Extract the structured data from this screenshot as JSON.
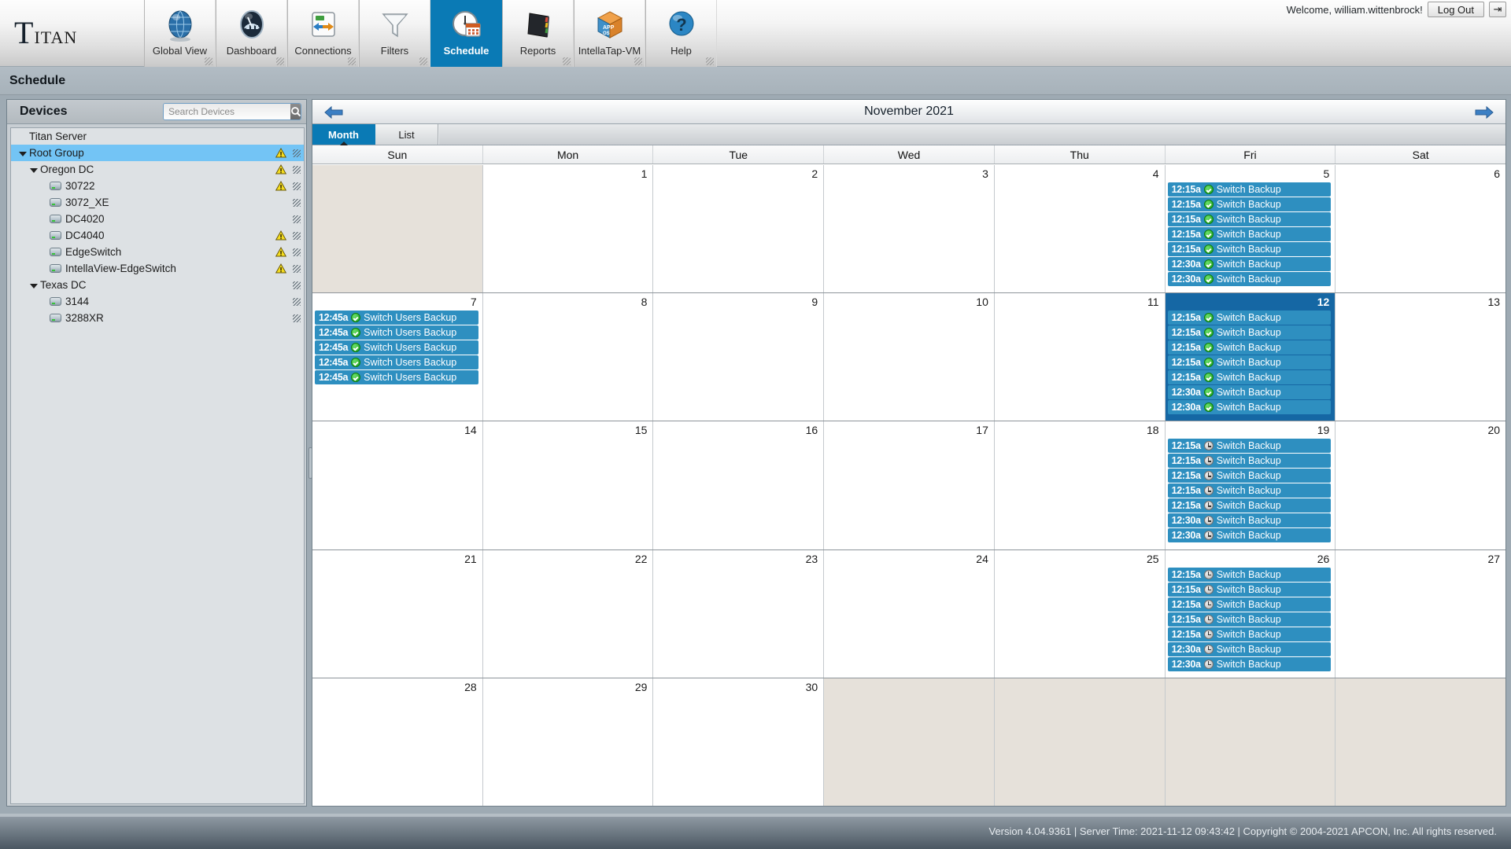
{
  "app": {
    "logo_first": "T",
    "logo_rest": "itan",
    "page_title": "Schedule"
  },
  "user": {
    "welcome": "Welcome, william.wittenbrock!",
    "logout_label": "Log Out",
    "logout_icon": "exit-icon"
  },
  "nav": {
    "items": [
      {
        "label": "Global View",
        "icon": "globe-icon",
        "active": false
      },
      {
        "label": "Dashboard",
        "icon": "gauge-icon",
        "active": false
      },
      {
        "label": "Connections",
        "icon": "arrows-icon",
        "active": false
      },
      {
        "label": "Filters",
        "icon": "funnel-icon",
        "active": false
      },
      {
        "label": "Schedule",
        "icon": "clock-calendar-icon",
        "active": true
      },
      {
        "label": "Reports",
        "icon": "notebook-icon",
        "active": false
      },
      {
        "label": "IntellaTap-VM",
        "icon": "cube-icon",
        "active": false
      },
      {
        "label": "Help",
        "icon": "question-icon",
        "active": false
      }
    ]
  },
  "sidebar": {
    "title": "Devices",
    "search": {
      "placeholder": "Search Devices",
      "value": "",
      "icon": "search-icon"
    },
    "tree": [
      {
        "label": "Titan Server",
        "indent": 0,
        "type": "server",
        "twisty": "none",
        "warn": false,
        "grip": false,
        "selected": false
      },
      {
        "label": "Root Group",
        "indent": 0,
        "type": "group",
        "twisty": "open",
        "warn": true,
        "grip": true,
        "selected": true
      },
      {
        "label": "Oregon DC",
        "indent": 1,
        "type": "group",
        "twisty": "open",
        "warn": true,
        "grip": true,
        "selected": false
      },
      {
        "label": "30722",
        "indent": 2,
        "type": "device",
        "twisty": "none",
        "warn": true,
        "grip": true,
        "selected": false
      },
      {
        "label": "3072_XE",
        "indent": 2,
        "type": "device",
        "twisty": "none",
        "warn": false,
        "grip": true,
        "selected": false
      },
      {
        "label": "DC4020",
        "indent": 2,
        "type": "device",
        "twisty": "none",
        "warn": false,
        "grip": true,
        "selected": false
      },
      {
        "label": "DC4040",
        "indent": 2,
        "type": "device",
        "twisty": "none",
        "warn": true,
        "grip": true,
        "selected": false
      },
      {
        "label": "EdgeSwitch",
        "indent": 2,
        "type": "device",
        "twisty": "none",
        "warn": true,
        "grip": true,
        "selected": false
      },
      {
        "label": "IntellaView-EdgeSwitch",
        "indent": 2,
        "type": "device",
        "twisty": "none",
        "warn": true,
        "grip": true,
        "selected": false
      },
      {
        "label": "Texas DC",
        "indent": 1,
        "type": "group",
        "twisty": "open",
        "warn": false,
        "grip": true,
        "selected": false
      },
      {
        "label": "3144",
        "indent": 2,
        "type": "device",
        "twisty": "none",
        "warn": false,
        "grip": true,
        "selected": false
      },
      {
        "label": "3288XR",
        "indent": 2,
        "type": "device",
        "twisty": "none",
        "warn": false,
        "grip": true,
        "selected": false
      }
    ]
  },
  "calendar": {
    "month_title": "November 2021",
    "prev_icon": "arrow-left-icon",
    "next_icon": "arrow-right-icon",
    "tabs": [
      {
        "label": "Month",
        "active": true
      },
      {
        "label": "List",
        "active": false
      }
    ],
    "day_headers": [
      "Sun",
      "Mon",
      "Tue",
      "Wed",
      "Thu",
      "Fri",
      "Sat"
    ],
    "weeks": [
      [
        {
          "num": "",
          "other": true,
          "today": false,
          "events": []
        },
        {
          "num": "1",
          "other": false,
          "today": false,
          "events": []
        },
        {
          "num": "2",
          "other": false,
          "today": false,
          "events": []
        },
        {
          "num": "3",
          "other": false,
          "today": false,
          "events": []
        },
        {
          "num": "4",
          "other": false,
          "today": false,
          "events": []
        },
        {
          "num": "5",
          "other": false,
          "today": false,
          "events": [
            {
              "time": "12:15a",
              "name": "Switch Backup",
              "status": "ok"
            },
            {
              "time": "12:15a",
              "name": "Switch Backup",
              "status": "ok"
            },
            {
              "time": "12:15a",
              "name": "Switch Backup",
              "status": "ok"
            },
            {
              "time": "12:15a",
              "name": "Switch Backup",
              "status": "ok"
            },
            {
              "time": "12:15a",
              "name": "Switch Backup",
              "status": "ok"
            },
            {
              "time": "12:30a",
              "name": "Switch Backup",
              "status": "ok"
            },
            {
              "time": "12:30a",
              "name": "Switch Backup",
              "status": "ok"
            }
          ]
        },
        {
          "num": "6",
          "other": false,
          "today": false,
          "events": []
        }
      ],
      [
        {
          "num": "7",
          "other": false,
          "today": false,
          "events": [
            {
              "time": "12:45a",
              "name": "Switch Users Backup",
              "status": "ok"
            },
            {
              "time": "12:45a",
              "name": "Switch Users Backup",
              "status": "ok"
            },
            {
              "time": "12:45a",
              "name": "Switch Users Backup",
              "status": "ok"
            },
            {
              "time": "12:45a",
              "name": "Switch Users Backup",
              "status": "ok"
            },
            {
              "time": "12:45a",
              "name": "Switch Users Backup",
              "status": "ok"
            }
          ]
        },
        {
          "num": "8",
          "other": false,
          "today": false,
          "events": []
        },
        {
          "num": "9",
          "other": false,
          "today": false,
          "events": []
        },
        {
          "num": "10",
          "other": false,
          "today": false,
          "events": []
        },
        {
          "num": "11",
          "other": false,
          "today": false,
          "events": []
        },
        {
          "num": "12",
          "other": false,
          "today": true,
          "events": [
            {
              "time": "12:15a",
              "name": "Switch Backup",
              "status": "ok"
            },
            {
              "time": "12:15a",
              "name": "Switch Backup",
              "status": "ok"
            },
            {
              "time": "12:15a",
              "name": "Switch Backup",
              "status": "ok"
            },
            {
              "time": "12:15a",
              "name": "Switch Backup",
              "status": "ok"
            },
            {
              "time": "12:15a",
              "name": "Switch Backup",
              "status": "ok"
            },
            {
              "time": "12:30a",
              "name": "Switch Backup",
              "status": "ok"
            },
            {
              "time": "12:30a",
              "name": "Switch Backup",
              "status": "ok"
            }
          ]
        },
        {
          "num": "13",
          "other": false,
          "today": false,
          "events": []
        }
      ],
      [
        {
          "num": "14",
          "other": false,
          "today": false,
          "events": []
        },
        {
          "num": "15",
          "other": false,
          "today": false,
          "events": []
        },
        {
          "num": "16",
          "other": false,
          "today": false,
          "events": []
        },
        {
          "num": "17",
          "other": false,
          "today": false,
          "events": []
        },
        {
          "num": "18",
          "other": false,
          "today": false,
          "events": []
        },
        {
          "num": "19",
          "other": false,
          "today": false,
          "events": [
            {
              "time": "12:15a",
              "name": "Switch Backup",
              "status": "pending"
            },
            {
              "time": "12:15a",
              "name": "Switch Backup",
              "status": "pending"
            },
            {
              "time": "12:15a",
              "name": "Switch Backup",
              "status": "pending"
            },
            {
              "time": "12:15a",
              "name": "Switch Backup",
              "status": "pending"
            },
            {
              "time": "12:15a",
              "name": "Switch Backup",
              "status": "pending"
            },
            {
              "time": "12:30a",
              "name": "Switch Backup",
              "status": "pending"
            },
            {
              "time": "12:30a",
              "name": "Switch Backup",
              "status": "pending"
            }
          ]
        },
        {
          "num": "20",
          "other": false,
          "today": false,
          "events": []
        }
      ],
      [
        {
          "num": "21",
          "other": false,
          "today": false,
          "events": []
        },
        {
          "num": "22",
          "other": false,
          "today": false,
          "events": []
        },
        {
          "num": "23",
          "other": false,
          "today": false,
          "events": []
        },
        {
          "num": "24",
          "other": false,
          "today": false,
          "events": []
        },
        {
          "num": "25",
          "other": false,
          "today": false,
          "events": []
        },
        {
          "num": "26",
          "other": false,
          "today": false,
          "events": [
            {
              "time": "12:15a",
              "name": "Switch Backup",
              "status": "pending"
            },
            {
              "time": "12:15a",
              "name": "Switch Backup",
              "status": "pending"
            },
            {
              "time": "12:15a",
              "name": "Switch Backup",
              "status": "pending"
            },
            {
              "time": "12:15a",
              "name": "Switch Backup",
              "status": "pending"
            },
            {
              "time": "12:15a",
              "name": "Switch Backup",
              "status": "pending"
            },
            {
              "time": "12:30a",
              "name": "Switch Backup",
              "status": "pending"
            },
            {
              "time": "12:30a",
              "name": "Switch Backup",
              "status": "pending"
            }
          ]
        },
        {
          "num": "27",
          "other": false,
          "today": false,
          "events": []
        }
      ],
      [
        {
          "num": "28",
          "other": false,
          "today": false,
          "events": []
        },
        {
          "num": "29",
          "other": false,
          "today": false,
          "events": []
        },
        {
          "num": "30",
          "other": false,
          "today": false,
          "events": []
        },
        {
          "num": "",
          "other": true,
          "today": false,
          "events": []
        },
        {
          "num": "",
          "other": true,
          "today": false,
          "events": []
        },
        {
          "num": "",
          "other": true,
          "today": false,
          "events": []
        },
        {
          "num": "",
          "other": true,
          "today": false,
          "events": []
        }
      ]
    ]
  },
  "footer": {
    "text": "Version 4.04.9361 | Server Time: 2021-11-12 09:43:42 | Copyright © 2004-2021 APCON, Inc. All rights reserved."
  },
  "colors": {
    "accent": "#0a7ab5",
    "event_blue": "#2e8fc0",
    "today_blue": "#1567a4",
    "select_blue": "#73c4f5"
  }
}
